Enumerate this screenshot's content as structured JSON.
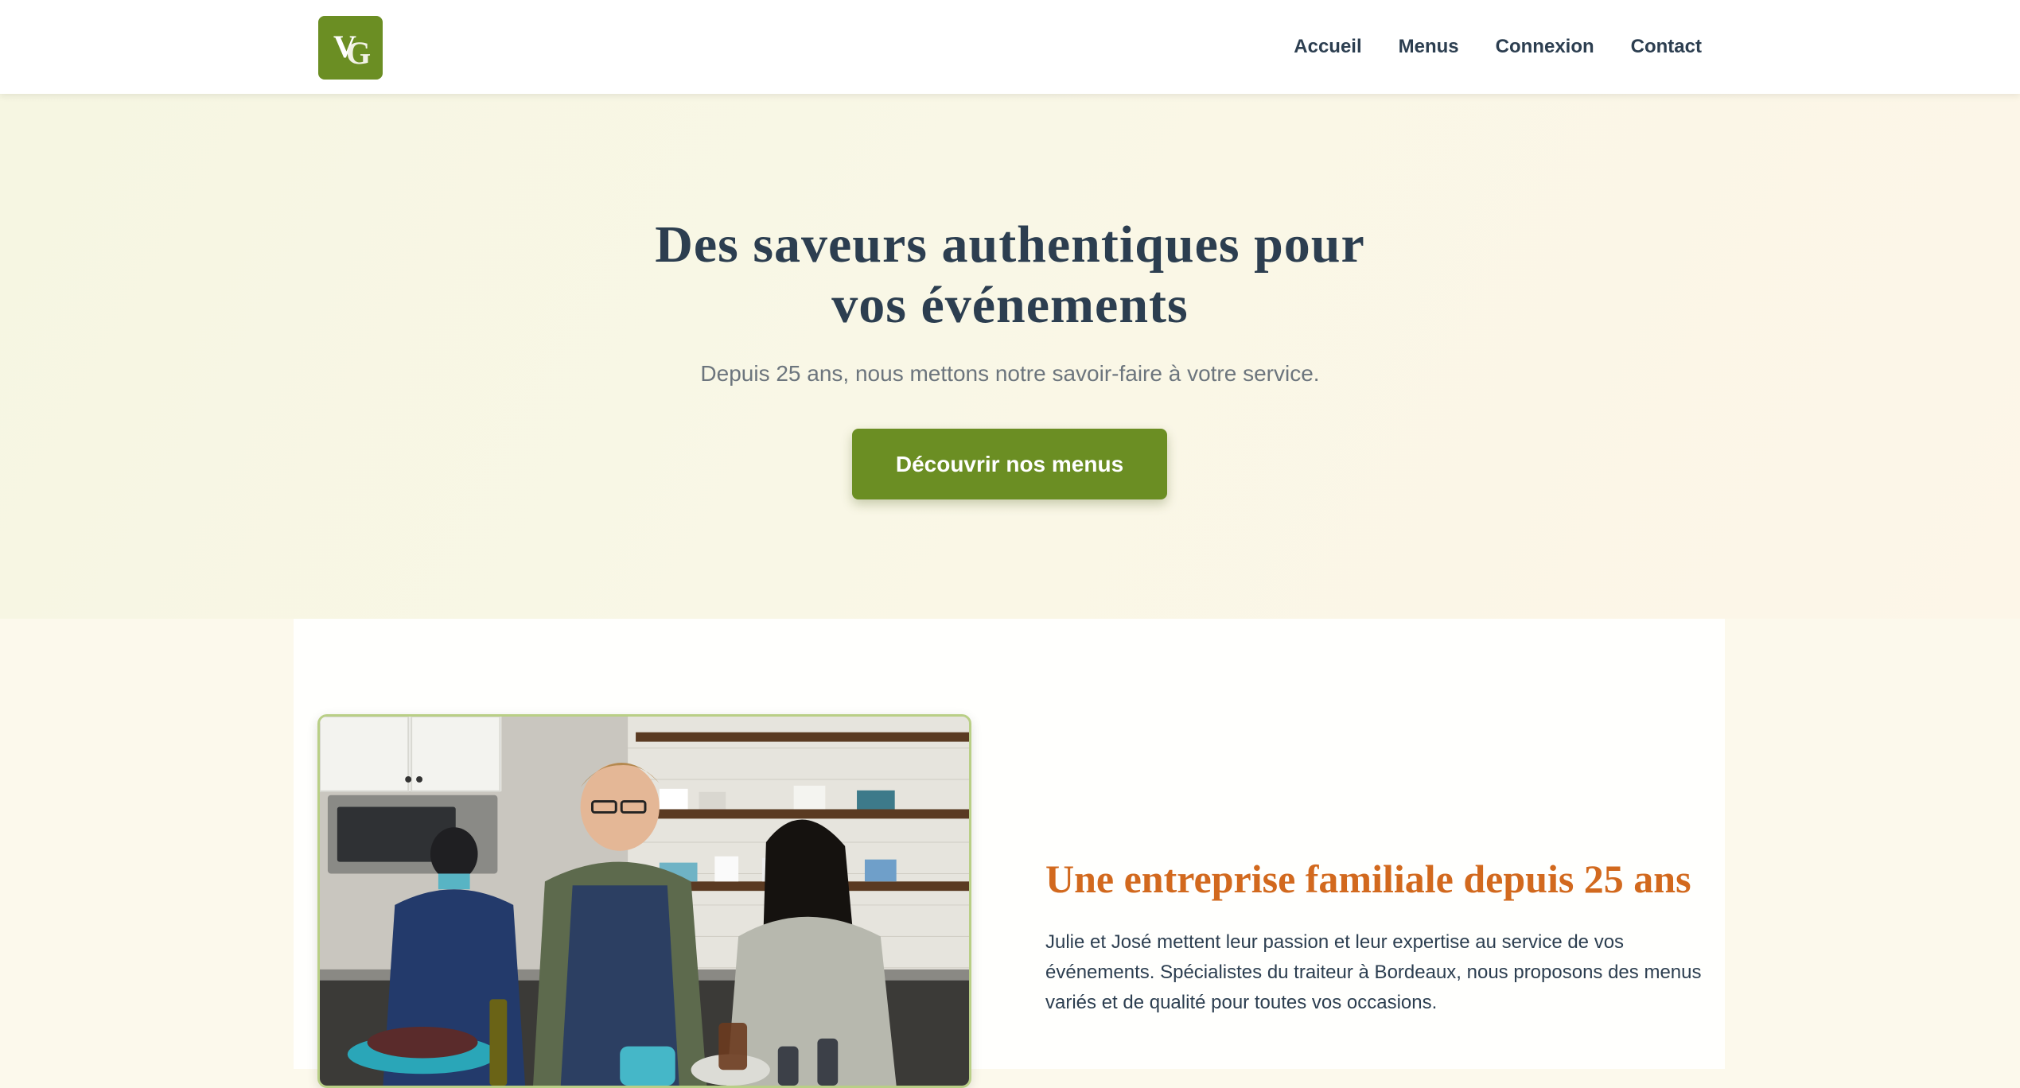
{
  "header": {
    "logo_text": "VG",
    "nav": [
      {
        "label": "Accueil"
      },
      {
        "label": "Menus"
      },
      {
        "label": "Connexion"
      },
      {
        "label": "Contact"
      }
    ]
  },
  "hero": {
    "title": "Des saveurs authentiques pour vos événements",
    "subtitle": "Depuis 25 ans, nous mettons notre savoir-faire à votre service.",
    "cta_label": "Découvrir nos menus"
  },
  "about": {
    "title": "Une entreprise familiale depuis 25 ans",
    "description": "Julie et José mettent leur passion et leur expertise au service de vos événements. Spécialistes du traiteur à Bordeaux, nous proposons des menus variés et de qualité pour toutes vos occasions.",
    "photo_icon": "kitchen-photo"
  },
  "colors": {
    "brand_green": "#6b8e23",
    "accent_orange": "#d2691e",
    "text_dark": "#2c3e50",
    "text_muted": "#6c757d"
  }
}
